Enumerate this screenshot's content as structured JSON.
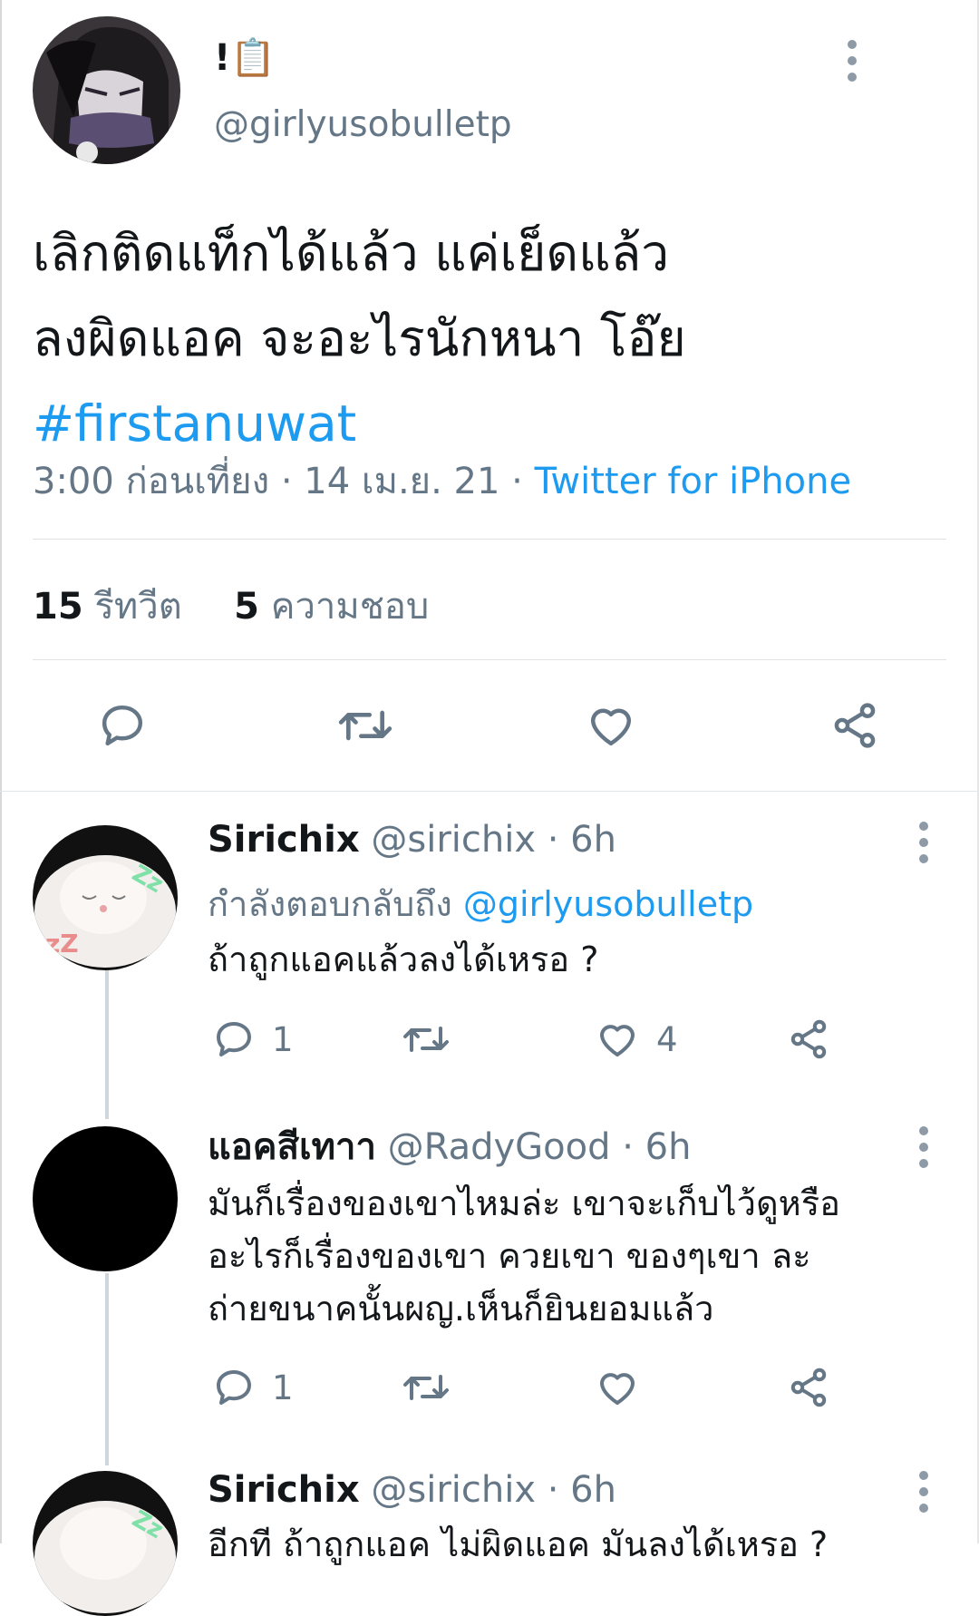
{
  "main_tweet": {
    "display_name": "!📋",
    "handle": "@girlyusobulletp",
    "text_lines": [
      "เลิกติดแท็กได้แล้ว แค่เย็ดแล้ว",
      "ลงผิดแอค จะอะไรนักหนา โอ๊ย"
    ],
    "hashtag": "#firstanuwat",
    "time": "3:00 ก่อนเที่ยง",
    "date": "14 เม.ย. 21",
    "separator": "·",
    "source": "Twitter for iPhone",
    "retweet_count": "15",
    "retweet_label": "รีทวีต",
    "like_count": "5",
    "like_label": "ความชอบ"
  },
  "replies": [
    {
      "display_name": "Sirichix",
      "handle": "@sirichix · 6h",
      "replying_prefix": "กำลังตอบกลับถึง",
      "replying_to": "@girlyusobulletp",
      "text_lines": [
        "ถ้าถูกแอคแล้วลงได้เหรอ ?"
      ],
      "reply_count": "1",
      "like_count": "4"
    },
    {
      "display_name": "แอคสีเทาา",
      "handle": "@RadyGood · 6h",
      "text_lines": [
        "มันก็เรื่องของเขาไหมล่ะ เขาจะเก็บไว้ดูหรือ",
        "อะไรก็เรื่องของเขา ควยเขา ของๆเขา ละ",
        "ถ่ายขนาคนั้นผญ.เห็นก็ยินยอมแล้ว"
      ],
      "reply_count": "1",
      "like_count": ""
    },
    {
      "display_name": "Sirichix",
      "handle": "@sirichix · 6h",
      "text_lines": [
        "อีกที ถ้าถูกแอค ไม่ผิดแอค มันลงได้เหรอ ?"
      ]
    }
  ],
  "icons": {
    "reply": "reply-bubble-icon",
    "retweet": "retweet-icon",
    "like": "heart-icon",
    "share": "share-icon",
    "more": "more-vertical-icon"
  },
  "colors": {
    "link": "#1d9bf0",
    "secondary_text": "#657786",
    "icon": "#657786",
    "divider": "#dfe3e6"
  }
}
